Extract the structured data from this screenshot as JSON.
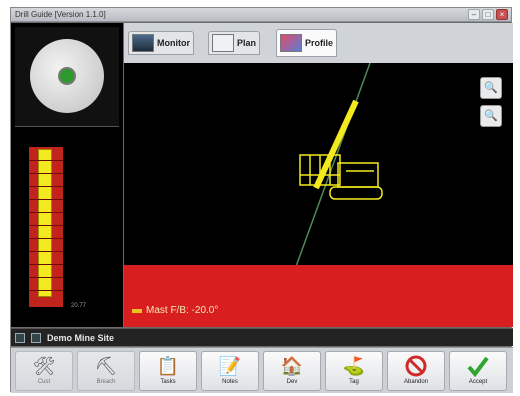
{
  "window": {
    "title": "Drill Guide [Version 1.1.0]"
  },
  "tabs": [
    {
      "label": "Monitor",
      "icon": "monitor-icon"
    },
    {
      "label": "Plan",
      "icon": "plan-icon"
    },
    {
      "label": "Profile",
      "icon": "profile-icon",
      "active": true
    }
  ],
  "depth_panel": {
    "label": "20.77"
  },
  "main_view": {
    "mast_label": "Mast F/B: -20.0°"
  },
  "status": {
    "site_name": "Demo Mine Site"
  },
  "toolbar": {
    "buttons": [
      {
        "label": "Cust",
        "icon": "drill-rig-icon",
        "enabled": false
      },
      {
        "label": "Breach",
        "icon": "drill-head-icon",
        "enabled": false
      },
      {
        "label": "Tasks",
        "icon": "tasks-icon",
        "enabled": true
      },
      {
        "label": "Notes",
        "icon": "notes-icon",
        "enabled": true
      },
      {
        "label": "Dev",
        "icon": "dev-icon",
        "enabled": true
      },
      {
        "label": "Tag",
        "icon": "tag-flag-icon",
        "enabled": true
      },
      {
        "label": "Abandon",
        "icon": "abandon-icon",
        "enabled": true
      },
      {
        "label": "Accept",
        "icon": "accept-checkmark-icon",
        "enabled": true
      }
    ]
  },
  "colors": {
    "ground": "#d81e1e",
    "rig": "#f2ea1e",
    "depth_fill": "#f2ea1e",
    "accept": "#2fa52f",
    "abandon": "#d02a2a"
  }
}
